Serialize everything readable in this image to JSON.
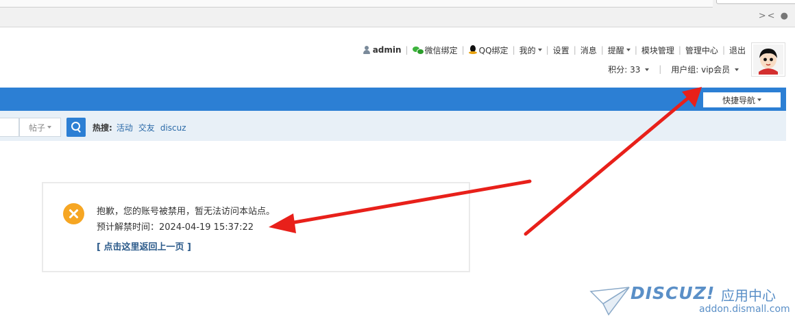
{
  "header": {
    "username": "admin",
    "links": [
      {
        "label": "微信绑定",
        "icon": "wechat-icon"
      },
      {
        "label": "QQ绑定",
        "icon": "qq-icon"
      },
      {
        "label": "我的",
        "dropdown": true
      },
      {
        "label": "设置"
      },
      {
        "label": "消息"
      },
      {
        "label": "提醒",
        "dropdown": true
      },
      {
        "label": "模块管理"
      },
      {
        "label": "管理中心"
      },
      {
        "label": "退出"
      }
    ],
    "credits": "积分: 33",
    "usergroup": "用户组: vip会员"
  },
  "nav": {
    "quick_nav_label": "快捷导航",
    "accent": "#2c7fd4"
  },
  "search": {
    "type_label": "帖子",
    "hot_label": "热搜:",
    "hot_items": [
      "活动",
      "交友",
      "discuz"
    ]
  },
  "message": {
    "line1": "抱歉，您的账号被禁用，暂无法访问本站点。",
    "line2": "预计解禁时间：2024-04-19 15:37:22",
    "back_link": "[ 点击这里返回上一页 ]",
    "icon": "error-icon",
    "icon_color": "#f6a623"
  },
  "watermark": {
    "brand": "DISCUZ!",
    "cn": "应用中心",
    "url": "addon.dismall.com"
  },
  "annotation_color": "#e8201a"
}
